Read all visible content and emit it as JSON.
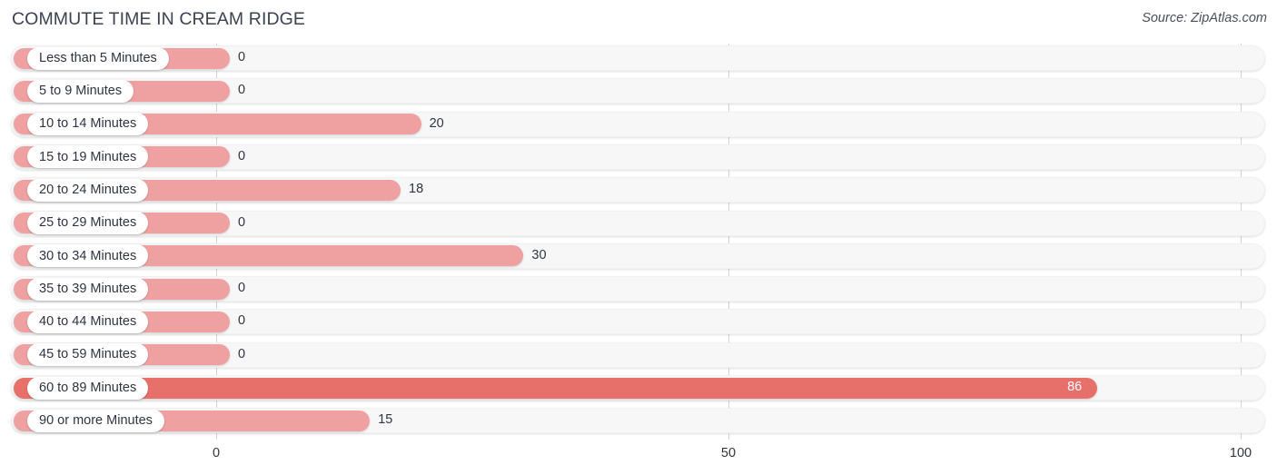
{
  "header": {
    "title": "COMMUTE TIME IN CREAM RIDGE",
    "source": "Source: ZipAtlas.com"
  },
  "colors": {
    "bar": "#efa1a1",
    "bar_highlight": "#e8706a",
    "track": "#f7f7f7",
    "gridline": "#d4d4d6",
    "text": "#303540",
    "title": "#3c4250"
  },
  "chart_data": {
    "type": "bar",
    "orientation": "horizontal",
    "title": "COMMUTE TIME IN CREAM RIDGE",
    "xlabel": "",
    "ylabel": "",
    "xlim": [
      0,
      100
    ],
    "ticks": [
      "0",
      "50",
      "100"
    ],
    "tick_values": [
      0,
      50,
      100
    ],
    "grid": true,
    "legend": false,
    "categories": [
      "Less than 5 Minutes",
      "5 to 9 Minutes",
      "10 to 14 Minutes",
      "15 to 19 Minutes",
      "20 to 24 Minutes",
      "25 to 29 Minutes",
      "30 to 34 Minutes",
      "35 to 39 Minutes",
      "40 to 44 Minutes",
      "45 to 59 Minutes",
      "60 to 89 Minutes",
      "90 or more Minutes"
    ],
    "values": [
      0,
      0,
      20,
      0,
      18,
      0,
      30,
      0,
      0,
      0,
      86,
      15
    ],
    "value_labels": [
      "0",
      "0",
      "20",
      "0",
      "18",
      "0",
      "30",
      "0",
      "0",
      "0",
      "86",
      "15"
    ],
    "highlight_index": 10
  }
}
